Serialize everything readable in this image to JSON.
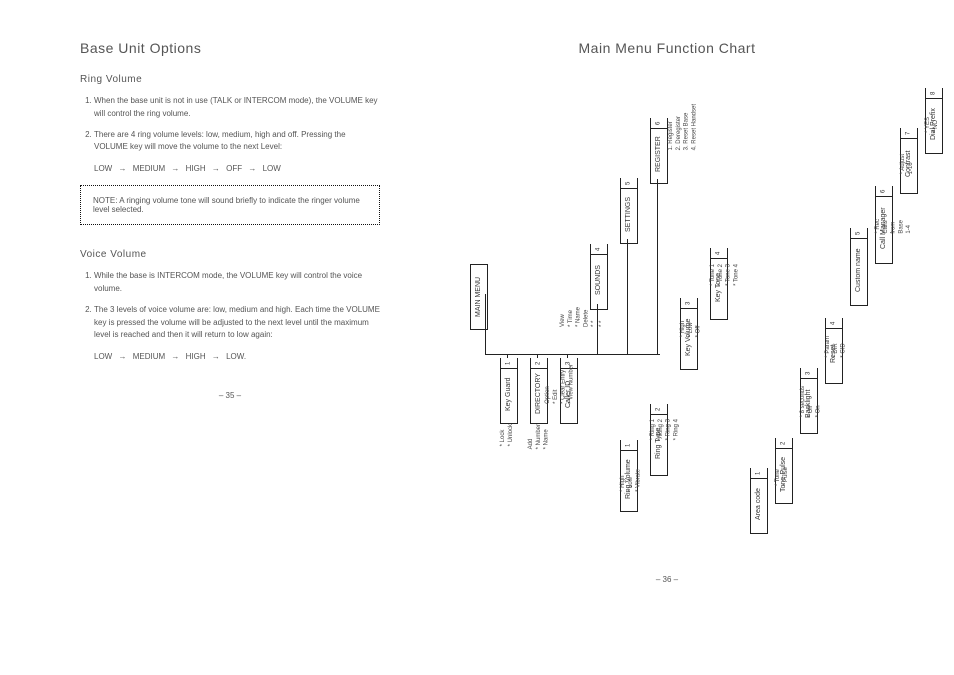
{
  "left": {
    "title": "Base Unit Options",
    "ring": {
      "heading": "Ring Volume",
      "item1": "When the base unit is not in use (TALK or INTERCOM mode), the VOLUME key will control the ring volume.",
      "item2": "There are 4 ring volume levels: low, medium, high and off. Pressing the VOLUME key will move the volume to the next Level:",
      "seq_low": "LOW",
      "seq_med": "MEDIUM",
      "seq_high": "HIGH",
      "seq_off": "OFF",
      "seq_low2": "LOW",
      "note": "NOTE: A ringing volume tone will sound briefly to indicate the ringer volume level selected."
    },
    "voice": {
      "heading": "Voice Volume",
      "item1": "While the base is INTERCOM mode, the VOLUME key will control the voice volume.",
      "item2": "The 3 levels of voice volume are: low, medium and high. Each time the VOLUME key is pressed the volume will be adjusted to the next level until the maximum level is reached and then it will return to low again:",
      "seq_low": "LOW",
      "seq_med": "MEDIUM",
      "seq_high": "HIGH",
      "seq_low2": "LOW."
    },
    "pagenum": "– 35 –"
  },
  "right": {
    "title": "Main Menu Function Chart",
    "pagenum": "– 36 –",
    "root": "MAIN MENU",
    "l1": {
      "b1": "Key Guard",
      "n1": "1",
      "b2": "DIRECTORY",
      "n2": "2",
      "b3": "Caller ID",
      "n3": "3",
      "b4": "SOUNDS",
      "n4": "4",
      "b5": "SETTINGS",
      "n5": "5",
      "b6": "REGISTER",
      "n6": "6"
    },
    "l1items": {
      "i1a": "* Lock",
      "i1b": "* Unlock",
      "i2a": "Add",
      "i2b": "* Number",
      "i2c": "* Name",
      "i2d": "Option",
      "i2e": "* Edit",
      "i2f": "* Clear Entry",
      "i2g": "* View Number",
      "i3a": "View",
      "i3b": "* Time",
      "i3c": "* Name",
      "i3d": "Delete",
      "i3e": "* *",
      "i3f": "* *",
      "i6a": "1. Register",
      "i6b": "2. Deregister",
      "i6c": "3. Reset Base",
      "i6d": "4. Reset Handset"
    },
    "l2": {
      "b1": "Ring Volume",
      "n1": "1",
      "b2": "Ring Type",
      "n2": "2",
      "b3": "Key Volume",
      "n3": "3",
      "b4": "Key Tone",
      "n4": "4"
    },
    "l2items": {
      "i1a": "* High",
      "i1b": "* Low",
      "i1c": "* Vibrate",
      "i2a": "* Ring 1",
      "i2b": "* Ring 2",
      "i2c": "* Ring 3",
      "i2d": "* Ring 4",
      "i3a": "* High",
      "i3b": "* Low",
      "i3c": "* Off",
      "i4a": "* Tone 1",
      "i4b": "* Tone 2",
      "i4c": "* Tone 3",
      "i4d": "* Tone 4"
    },
    "l3": {
      "b1": "Area code",
      "n1": "1",
      "b2": "Tone-Pulse",
      "n2": "2",
      "b3": "Backlight",
      "n3": "3",
      "b4": "Reset",
      "n4": "4",
      "b5": "Custom name",
      "n5": "5",
      "b6": "Call Manager",
      "n6": "6",
      "b7": "Contrast",
      "n7": "7",
      "b8": "Dial Prefix",
      "n8": "8"
    },
    "l3items": {
      "i2a": "* Tone",
      "i2b": "* Pulse",
      "i3a": "* 8 seconds",
      "i3b": "* Off",
      "i3c": "* On",
      "i4a": "* Param",
      "i4b": "* DIR",
      "i4c": "* CID",
      "i6a": "* Rec",
      "i6b": "Calls",
      "i6c": "from",
      "i6d": "Base",
      "i6e": "1-4",
      "i7a": "* Adjust",
      "i7b": "1-16",
      "i8a": "* YES",
      "i8b": "* NO"
    }
  },
  "arrow_glyph": "→"
}
